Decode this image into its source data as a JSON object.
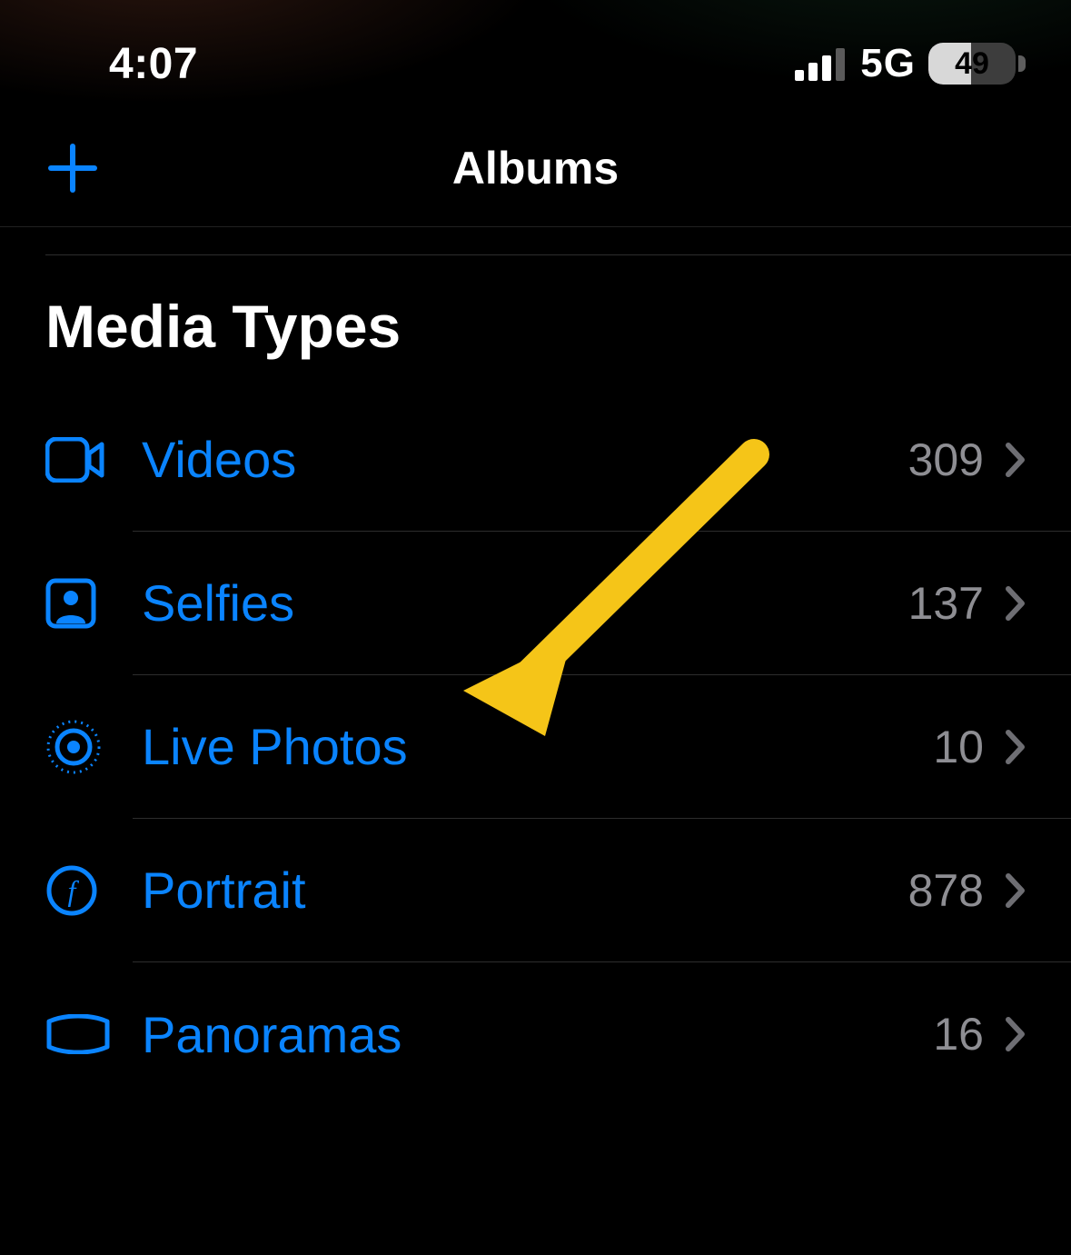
{
  "status": {
    "time": "4:07",
    "network": "5G",
    "battery": "49"
  },
  "nav": {
    "title": "Albums",
    "add_icon": "plus-icon"
  },
  "section": {
    "title": "Media Types"
  },
  "rows": [
    {
      "icon": "video-icon",
      "label": "Videos",
      "count": "309"
    },
    {
      "icon": "selfies-icon",
      "label": "Selfies",
      "count": "137"
    },
    {
      "icon": "livephotos-icon",
      "label": "Live Photos",
      "count": "10"
    },
    {
      "icon": "portrait-icon",
      "label": "Portrait",
      "count": "878"
    },
    {
      "icon": "panoramas-icon",
      "label": "Panoramas",
      "count": "16"
    }
  ],
  "annotation": {
    "arrow_color": "#f5c518"
  }
}
